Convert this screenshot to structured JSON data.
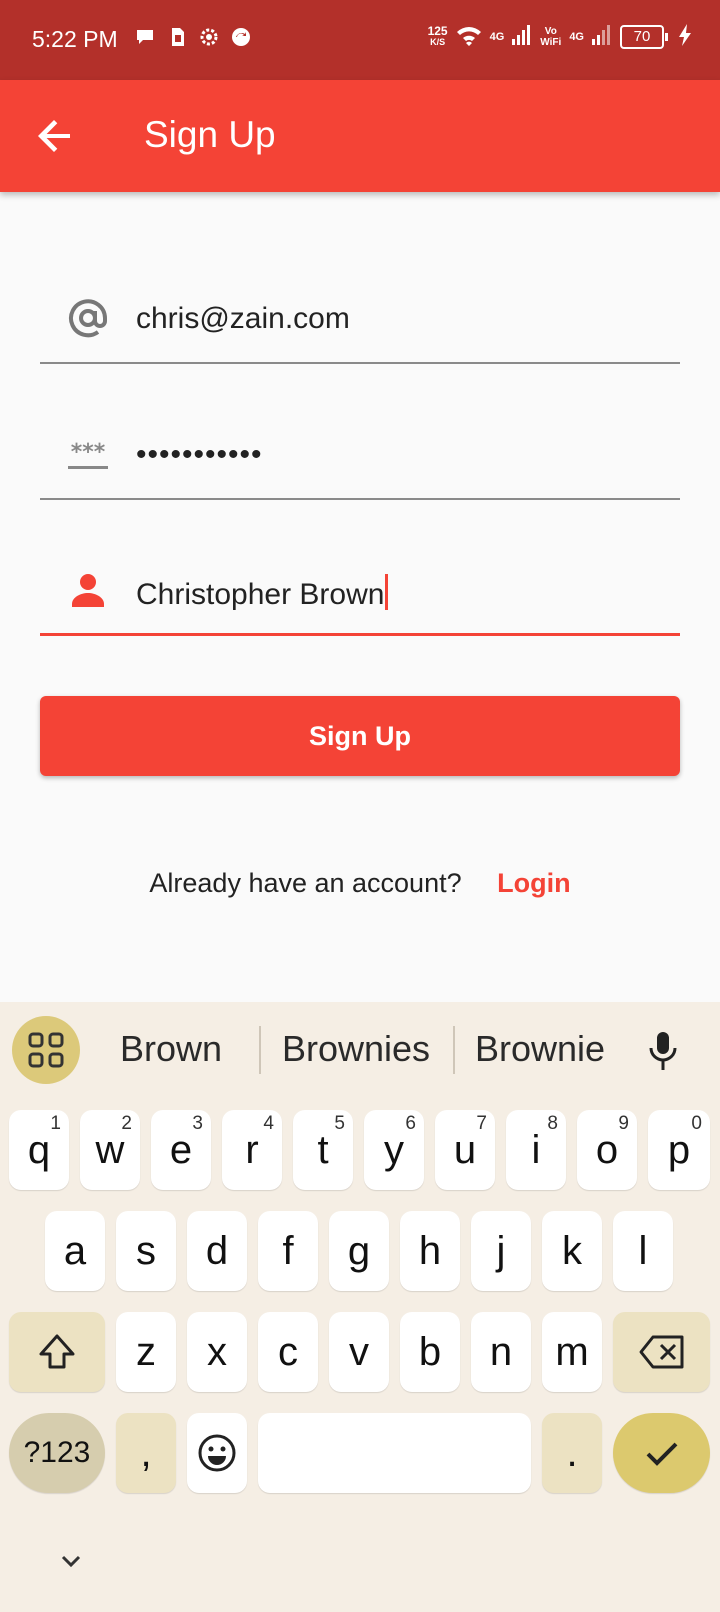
{
  "status_bar": {
    "time": "5:22 PM",
    "speed_value": "125",
    "speed_unit": "K/S",
    "net1": "4G",
    "net2_top": "Vo",
    "net2_bottom": "WiFi",
    "net3": "4G",
    "battery": "70",
    "icons": [
      "chat-bubble-icon",
      "sim-icon",
      "settings-gear-icon",
      "sync-icon",
      "wifi-icon",
      "signal-icon",
      "charging-bolt-icon"
    ]
  },
  "app_bar": {
    "title": "Sign Up",
    "back_icon": "arrow-back-icon"
  },
  "form": {
    "email": {
      "value": "chris@zain.com",
      "icon": "at-sign-icon"
    },
    "password": {
      "value": "•••••••••••",
      "icon": "password-icon"
    },
    "name": {
      "value": "Christopher Brown",
      "icon": "person-icon"
    },
    "submit_label": "Sign Up",
    "login_prompt": "Already have an account?",
    "login_link": "Login"
  },
  "keyboard": {
    "suggestions": [
      "Brown",
      "Brownies",
      "Brownie"
    ],
    "row1": [
      {
        "k": "q",
        "h": "1"
      },
      {
        "k": "w",
        "h": "2"
      },
      {
        "k": "e",
        "h": "3"
      },
      {
        "k": "r",
        "h": "4"
      },
      {
        "k": "t",
        "h": "5"
      },
      {
        "k": "y",
        "h": "6"
      },
      {
        "k": "u",
        "h": "7"
      },
      {
        "k": "i",
        "h": "8"
      },
      {
        "k": "o",
        "h": "9"
      },
      {
        "k": "p",
        "h": "0"
      }
    ],
    "row2": [
      "a",
      "s",
      "d",
      "f",
      "g",
      "h",
      "j",
      "k",
      "l"
    ],
    "row3": [
      "z",
      "x",
      "c",
      "v",
      "b",
      "n",
      "m"
    ],
    "symbols_label": "?123",
    "comma": ",",
    "period": "."
  },
  "colors": {
    "status_bar": "#b3302a",
    "accent": "#f44336",
    "keyboard_bg": "#f5eee4",
    "key_mod": "#ece2c2",
    "done_key": "#dcc96e"
  }
}
